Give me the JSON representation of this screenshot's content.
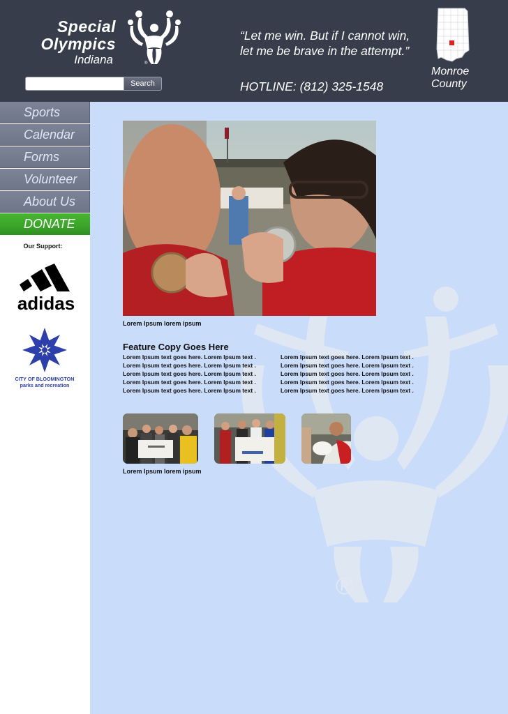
{
  "header": {
    "logo": {
      "line1": "Special",
      "line2": "Olympics",
      "line3": "Indiana"
    },
    "search": {
      "placeholder": "",
      "button_label": "Search"
    },
    "quote_line1": "“Let me win. But if I cannot win,",
    "quote_line2": "let me be brave in the attempt.”",
    "hotline": "HOTLINE: (812) 325-1548",
    "county_line1": "Monroe",
    "county_line2": "County"
  },
  "nav": {
    "items": [
      {
        "label": "Sports"
      },
      {
        "label": "Calendar"
      },
      {
        "label": "Forms"
      },
      {
        "label": "Volunteer"
      },
      {
        "label": "About Us"
      },
      {
        "label": "DONATE"
      }
    ]
  },
  "sidebar": {
    "support_label": "Our Support:",
    "sponsors": {
      "adidas": "adidas",
      "city_line1": "CITY OF BLOOMINGTON",
      "city_line2": "parks and recreation"
    }
  },
  "main": {
    "hero_caption": "Lorem Ipsum lorem ipsum",
    "feature_title": "Feature Copy Goes Here",
    "feature_col1": [
      "Lorem Ipsum text goes here. Lorem Ipsum text .",
      "Lorem Ipsum text goes here. Lorem Ipsum text .",
      "Lorem Ipsum text goes here. Lorem Ipsum text .",
      "Lorem Ipsum text goes here. Lorem Ipsum text .",
      "Lorem Ipsum text goes here. Lorem Ipsum text ."
    ],
    "feature_col2": [
      "Lorem Ipsum text goes here. Lorem Ipsum text .",
      "Lorem Ipsum text goes here. Lorem Ipsum text .",
      "Lorem Ipsum text goes here. Lorem Ipsum text .",
      "Lorem Ipsum text goes here. Lorem Ipsum text .",
      "Lorem Ipsum text goes here. Lorem Ipsum text ."
    ],
    "gallery_caption": "Lorem Ipsum lorem ipsum",
    "watermark_mark": "®"
  },
  "colors": {
    "header_bg": "#383d4b",
    "nav_bg": "#747a8d",
    "donate_bg": "#3fae2c",
    "main_bg": "#c9dcfa",
    "county_highlight": "#e02020",
    "city_logo_blue": "#2d3fa8"
  }
}
